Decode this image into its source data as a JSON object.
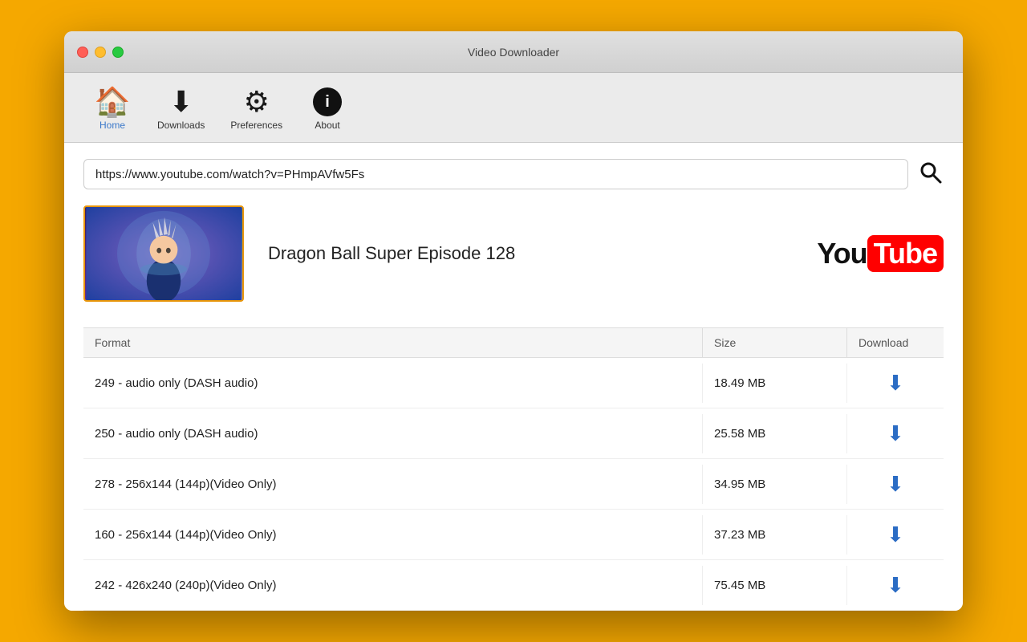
{
  "window": {
    "title": "Video Downloader"
  },
  "toolbar": {
    "items": [
      {
        "id": "home",
        "label": "Home",
        "icon": "🏠",
        "active": true
      },
      {
        "id": "downloads",
        "label": "Downloads",
        "icon": "⬇",
        "active": false
      },
      {
        "id": "preferences",
        "label": "Preferences",
        "icon": "⚙",
        "active": false
      },
      {
        "id": "about",
        "label": "About",
        "icon": "ℹ",
        "active": false
      }
    ]
  },
  "search": {
    "value": "https://www.youtube.com/watch?v=PHmpAVfw5Fs",
    "placeholder": "Enter video URL"
  },
  "video": {
    "title": "Dragon Ball Super Episode 128",
    "source": "YouTube"
  },
  "table": {
    "headers": [
      "Format",
      "Size",
      "Download"
    ],
    "rows": [
      {
        "format": "249 - audio only (DASH audio)",
        "size": "18.49 MB"
      },
      {
        "format": "250 - audio only (DASH audio)",
        "size": "25.58 MB"
      },
      {
        "format": "278 - 256x144 (144p)(Video Only)",
        "size": "34.95 MB"
      },
      {
        "format": "160 - 256x144 (144p)(Video Only)",
        "size": "37.23 MB"
      },
      {
        "format": "242 - 426x240 (240p)(Video Only)",
        "size": "75.45 MB"
      }
    ]
  },
  "youtube_logo": {
    "you": "You",
    "tube": "Tube"
  },
  "colors": {
    "accent_blue": "#3A78C9",
    "download_blue": "#2B6CC4",
    "youtube_red": "#FF0000",
    "background": "#F5A800"
  }
}
